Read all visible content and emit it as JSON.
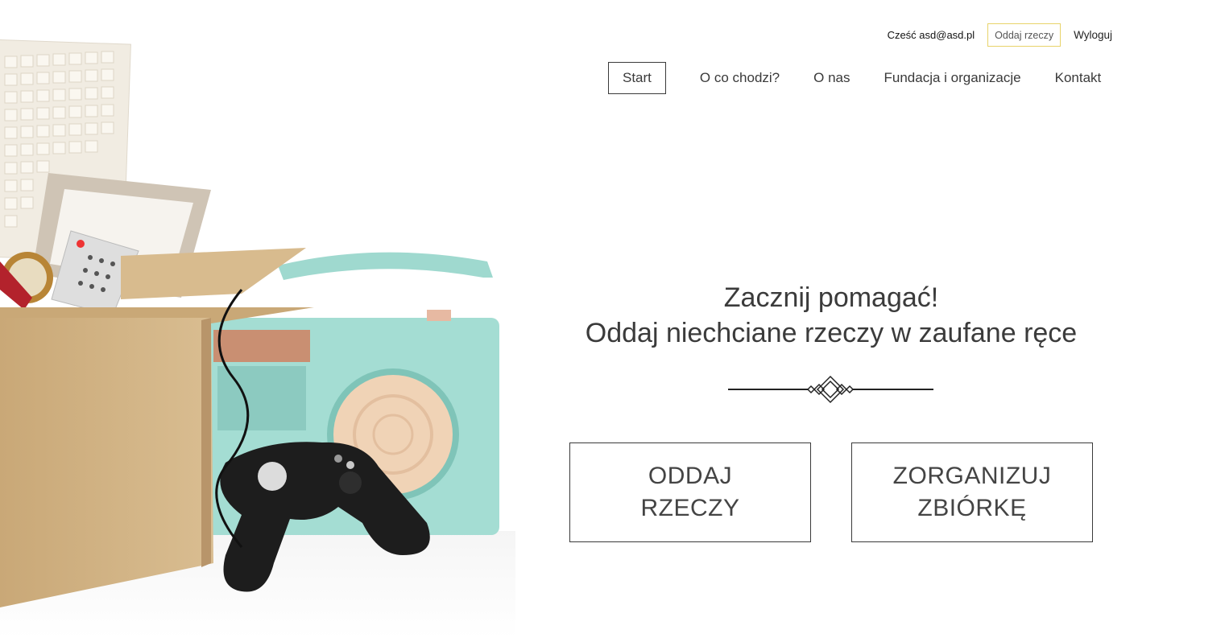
{
  "header": {
    "greeting": "Cześć asd@asd.pl",
    "give_button": "Oddaj rzeczy",
    "logout": "Wyloguj"
  },
  "nav": {
    "items": [
      {
        "label": "Start"
      },
      {
        "label": "O co chodzi?"
      },
      {
        "label": "O nas"
      },
      {
        "label": "Fundacja i organizacje"
      },
      {
        "label": "Kontakt"
      }
    ]
  },
  "hero": {
    "title_line1": "Zacznij pomagać!",
    "title_line2": "Oddaj niechciane rzeczy w zaufane ręce"
  },
  "actions": {
    "give_label": "ODDAJ RZECZY",
    "organize_label": "ZORGANIZUJ ZBIÓRKĘ"
  },
  "colors": {
    "accent_border": "#e8d36a",
    "text": "#3b3b3b",
    "background": "#ffffff"
  }
}
